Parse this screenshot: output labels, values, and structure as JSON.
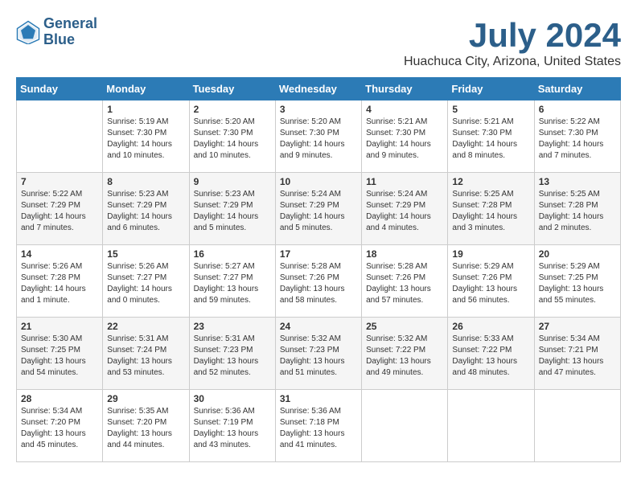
{
  "header": {
    "logo_line1": "General",
    "logo_line2": "Blue",
    "month_year": "July 2024",
    "location": "Huachuca City, Arizona, United States"
  },
  "weekdays": [
    "Sunday",
    "Monday",
    "Tuesday",
    "Wednesday",
    "Thursday",
    "Friday",
    "Saturday"
  ],
  "weeks": [
    [
      {
        "day": "",
        "info": ""
      },
      {
        "day": "1",
        "info": "Sunrise: 5:19 AM\nSunset: 7:30 PM\nDaylight: 14 hours\nand 10 minutes."
      },
      {
        "day": "2",
        "info": "Sunrise: 5:20 AM\nSunset: 7:30 PM\nDaylight: 14 hours\nand 10 minutes."
      },
      {
        "day": "3",
        "info": "Sunrise: 5:20 AM\nSunset: 7:30 PM\nDaylight: 14 hours\nand 9 minutes."
      },
      {
        "day": "4",
        "info": "Sunrise: 5:21 AM\nSunset: 7:30 PM\nDaylight: 14 hours\nand 9 minutes."
      },
      {
        "day": "5",
        "info": "Sunrise: 5:21 AM\nSunset: 7:30 PM\nDaylight: 14 hours\nand 8 minutes."
      },
      {
        "day": "6",
        "info": "Sunrise: 5:22 AM\nSunset: 7:30 PM\nDaylight: 14 hours\nand 7 minutes."
      }
    ],
    [
      {
        "day": "7",
        "info": "Sunrise: 5:22 AM\nSunset: 7:29 PM\nDaylight: 14 hours\nand 7 minutes."
      },
      {
        "day": "8",
        "info": "Sunrise: 5:23 AM\nSunset: 7:29 PM\nDaylight: 14 hours\nand 6 minutes."
      },
      {
        "day": "9",
        "info": "Sunrise: 5:23 AM\nSunset: 7:29 PM\nDaylight: 14 hours\nand 5 minutes."
      },
      {
        "day": "10",
        "info": "Sunrise: 5:24 AM\nSunset: 7:29 PM\nDaylight: 14 hours\nand 5 minutes."
      },
      {
        "day": "11",
        "info": "Sunrise: 5:24 AM\nSunset: 7:29 PM\nDaylight: 14 hours\nand 4 minutes."
      },
      {
        "day": "12",
        "info": "Sunrise: 5:25 AM\nSunset: 7:28 PM\nDaylight: 14 hours\nand 3 minutes."
      },
      {
        "day": "13",
        "info": "Sunrise: 5:25 AM\nSunset: 7:28 PM\nDaylight: 14 hours\nand 2 minutes."
      }
    ],
    [
      {
        "day": "14",
        "info": "Sunrise: 5:26 AM\nSunset: 7:28 PM\nDaylight: 14 hours\nand 1 minute."
      },
      {
        "day": "15",
        "info": "Sunrise: 5:26 AM\nSunset: 7:27 PM\nDaylight: 14 hours\nand 0 minutes."
      },
      {
        "day": "16",
        "info": "Sunrise: 5:27 AM\nSunset: 7:27 PM\nDaylight: 13 hours\nand 59 minutes."
      },
      {
        "day": "17",
        "info": "Sunrise: 5:28 AM\nSunset: 7:26 PM\nDaylight: 13 hours\nand 58 minutes."
      },
      {
        "day": "18",
        "info": "Sunrise: 5:28 AM\nSunset: 7:26 PM\nDaylight: 13 hours\nand 57 minutes."
      },
      {
        "day": "19",
        "info": "Sunrise: 5:29 AM\nSunset: 7:26 PM\nDaylight: 13 hours\nand 56 minutes."
      },
      {
        "day": "20",
        "info": "Sunrise: 5:29 AM\nSunset: 7:25 PM\nDaylight: 13 hours\nand 55 minutes."
      }
    ],
    [
      {
        "day": "21",
        "info": "Sunrise: 5:30 AM\nSunset: 7:25 PM\nDaylight: 13 hours\nand 54 minutes."
      },
      {
        "day": "22",
        "info": "Sunrise: 5:31 AM\nSunset: 7:24 PM\nDaylight: 13 hours\nand 53 minutes."
      },
      {
        "day": "23",
        "info": "Sunrise: 5:31 AM\nSunset: 7:23 PM\nDaylight: 13 hours\nand 52 minutes."
      },
      {
        "day": "24",
        "info": "Sunrise: 5:32 AM\nSunset: 7:23 PM\nDaylight: 13 hours\nand 51 minutes."
      },
      {
        "day": "25",
        "info": "Sunrise: 5:32 AM\nSunset: 7:22 PM\nDaylight: 13 hours\nand 49 minutes."
      },
      {
        "day": "26",
        "info": "Sunrise: 5:33 AM\nSunset: 7:22 PM\nDaylight: 13 hours\nand 48 minutes."
      },
      {
        "day": "27",
        "info": "Sunrise: 5:34 AM\nSunset: 7:21 PM\nDaylight: 13 hours\nand 47 minutes."
      }
    ],
    [
      {
        "day": "28",
        "info": "Sunrise: 5:34 AM\nSunset: 7:20 PM\nDaylight: 13 hours\nand 45 minutes."
      },
      {
        "day": "29",
        "info": "Sunrise: 5:35 AM\nSunset: 7:20 PM\nDaylight: 13 hours\nand 44 minutes."
      },
      {
        "day": "30",
        "info": "Sunrise: 5:36 AM\nSunset: 7:19 PM\nDaylight: 13 hours\nand 43 minutes."
      },
      {
        "day": "31",
        "info": "Sunrise: 5:36 AM\nSunset: 7:18 PM\nDaylight: 13 hours\nand 41 minutes."
      },
      {
        "day": "",
        "info": ""
      },
      {
        "day": "",
        "info": ""
      },
      {
        "day": "",
        "info": ""
      }
    ]
  ]
}
